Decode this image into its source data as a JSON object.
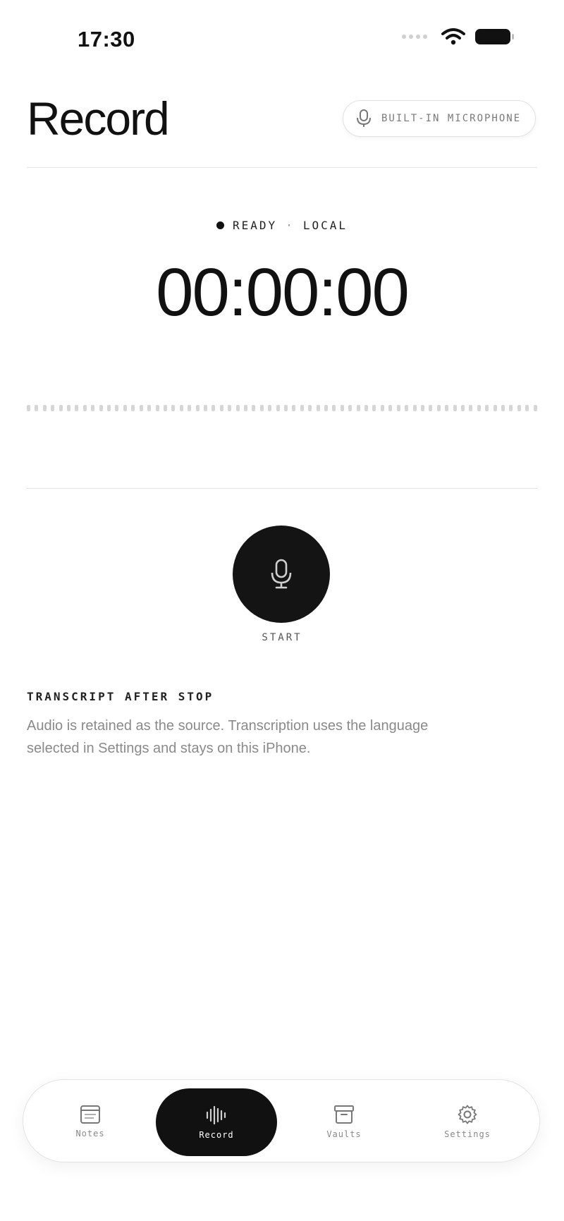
{
  "status_bar": {
    "time": "17:30"
  },
  "header": {
    "title": "Record",
    "input_chip_label": "BUILT-IN MICROPHONE"
  },
  "recorder": {
    "state": "READY",
    "separator": "·",
    "mode": "LOCAL",
    "elapsed": "00:00:00",
    "start_label": "START"
  },
  "info": {
    "title": "TRANSCRIPT AFTER STOP",
    "line1": "Audio is retained as the source. Transcription uses the language",
    "line2": "selected in Settings and stays on this iPhone."
  },
  "tabs": [
    {
      "label": "Notes",
      "icon": "notes-icon",
      "active": false
    },
    {
      "label": "Record",
      "icon": "waveform-icon",
      "active": true
    },
    {
      "label": "Vaults",
      "icon": "archive-box-icon",
      "active": false
    },
    {
      "label": "Settings",
      "icon": "gear-icon",
      "active": false
    }
  ],
  "colors": {
    "accent": "#111111",
    "muted_text": "#8a8a8a",
    "divider": "#e6e6e6"
  }
}
